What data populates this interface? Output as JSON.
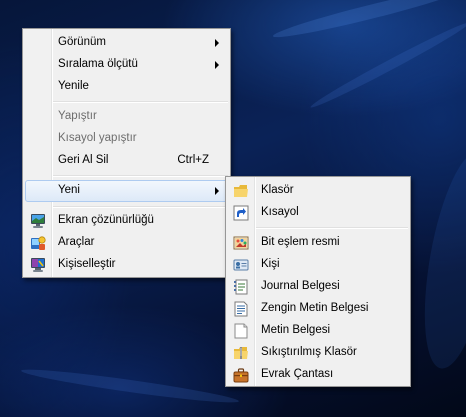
{
  "context_menu": {
    "items": [
      {
        "label": "Görünüm"
      },
      {
        "label": "Sıralama ölçütü"
      },
      {
        "label": "Yenile"
      },
      {
        "label": "Yapıştır"
      },
      {
        "label": "Kısayol yapıştır"
      },
      {
        "label": "Geri Al Sil",
        "accel": "Ctrl+Z"
      },
      {
        "label": "Yeni"
      },
      {
        "label": "Ekran çözünürlüğü",
        "icon": "display-icon"
      },
      {
        "label": "Araçlar",
        "icon": "gadgets-icon"
      },
      {
        "label": "Kişiselleştir",
        "icon": "personalize-icon"
      }
    ]
  },
  "submenu_new": {
    "items": [
      {
        "label": "Klasör",
        "icon": "folder-icon"
      },
      {
        "label": "Kısayol",
        "icon": "shortcut-icon"
      },
      {
        "label": "Bit eşlem resmi",
        "icon": "bitmap-icon"
      },
      {
        "label": "Kişi",
        "icon": "contact-icon"
      },
      {
        "label": "Journal Belgesi",
        "icon": "journal-icon"
      },
      {
        "label": "Zengin Metin Belgesi",
        "icon": "rtf-document-icon"
      },
      {
        "label": "Metin Belgesi",
        "icon": "text-document-icon"
      },
      {
        "label": "Sıkıştırılmış Klasör",
        "icon": "zip-folder-icon"
      },
      {
        "label": "Evrak Çantası",
        "icon": "briefcase-icon"
      }
    ]
  }
}
